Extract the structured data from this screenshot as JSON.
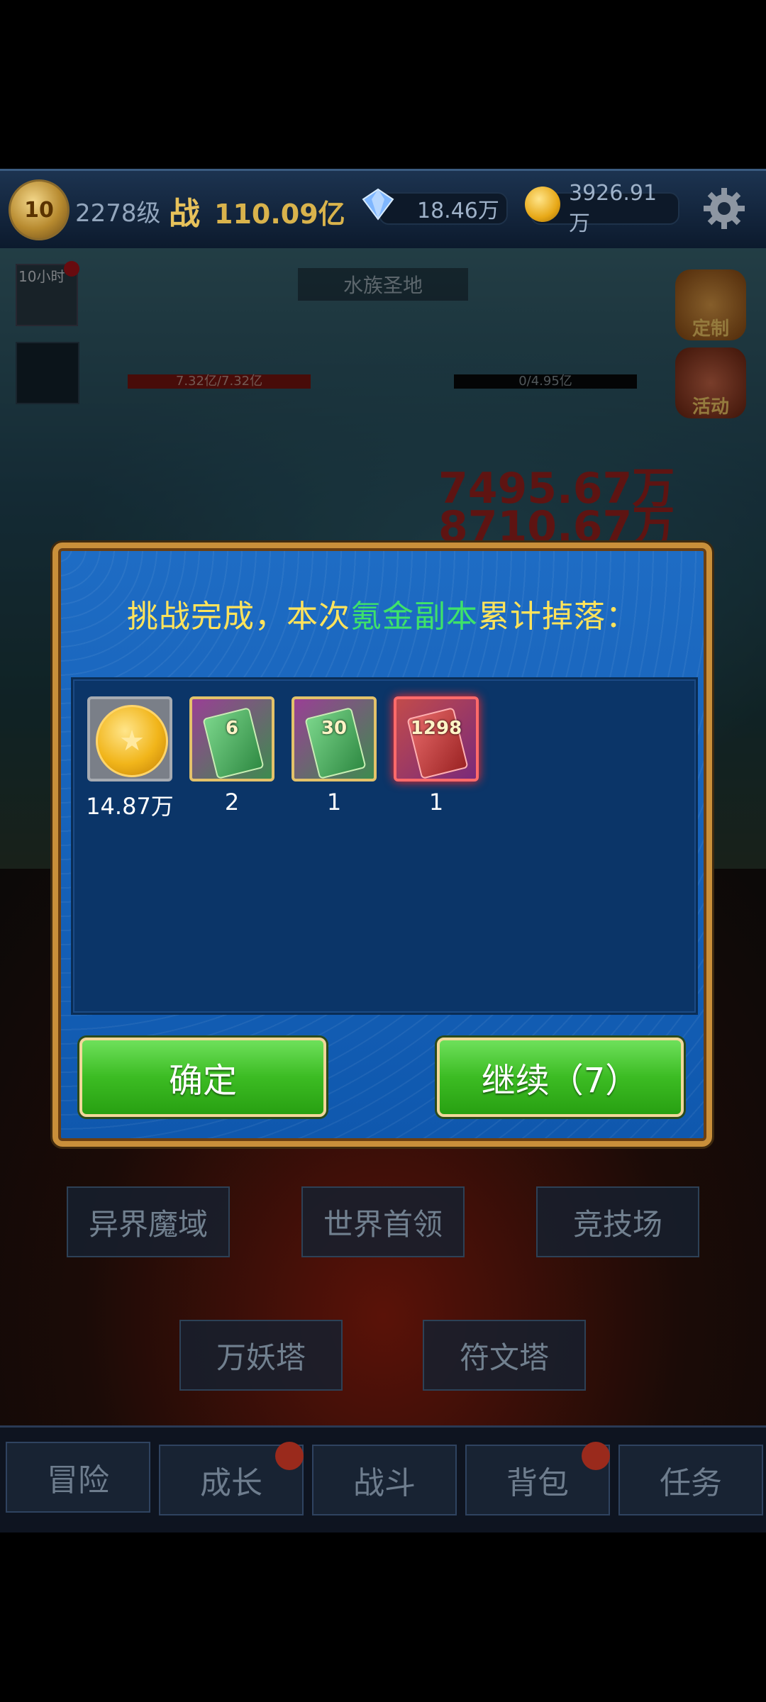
{
  "status_bar": {
    "level_badge": "10",
    "player_level": "2278级",
    "battle_label": "战",
    "battle_power": "110.09亿",
    "gems": "18.46万",
    "gold": "3926.91万",
    "icons": [
      "level-badge",
      "diamond-icon",
      "gold-coin-icon",
      "settings-gear-icon"
    ]
  },
  "scene": {
    "map_name": "水族圣地",
    "timer_label": "10小时",
    "boss_hp_left": "7.32亿/7.32亿",
    "boss_hp_right": "0/4.95亿",
    "damage_numbers": [
      "7495.67万",
      "8710.67万"
    ],
    "side_buttons": [
      "定制",
      "活动"
    ]
  },
  "dialog": {
    "title_prefix": "挑战完成，本次",
    "title_highlight": "氪金副本",
    "title_suffix": "累计掉落：",
    "rewards": [
      {
        "type": "gold-coin",
        "count": "14.87万"
      },
      {
        "type": "recharge-card",
        "value": "6",
        "count": "2"
      },
      {
        "type": "recharge-card",
        "value": "30",
        "count": "1"
      },
      {
        "type": "recharge-card",
        "value": "1298",
        "count": "1"
      }
    ],
    "confirm_label": "确定",
    "continue_label": "继续（7）"
  },
  "menu": {
    "row1": [
      "异界魔域",
      "世界首领",
      "竞技场"
    ],
    "row2": [
      "万妖塔",
      "符文塔"
    ]
  },
  "nav": {
    "items": [
      "冒险",
      "成长",
      "战斗",
      "背包",
      "任务"
    ]
  }
}
